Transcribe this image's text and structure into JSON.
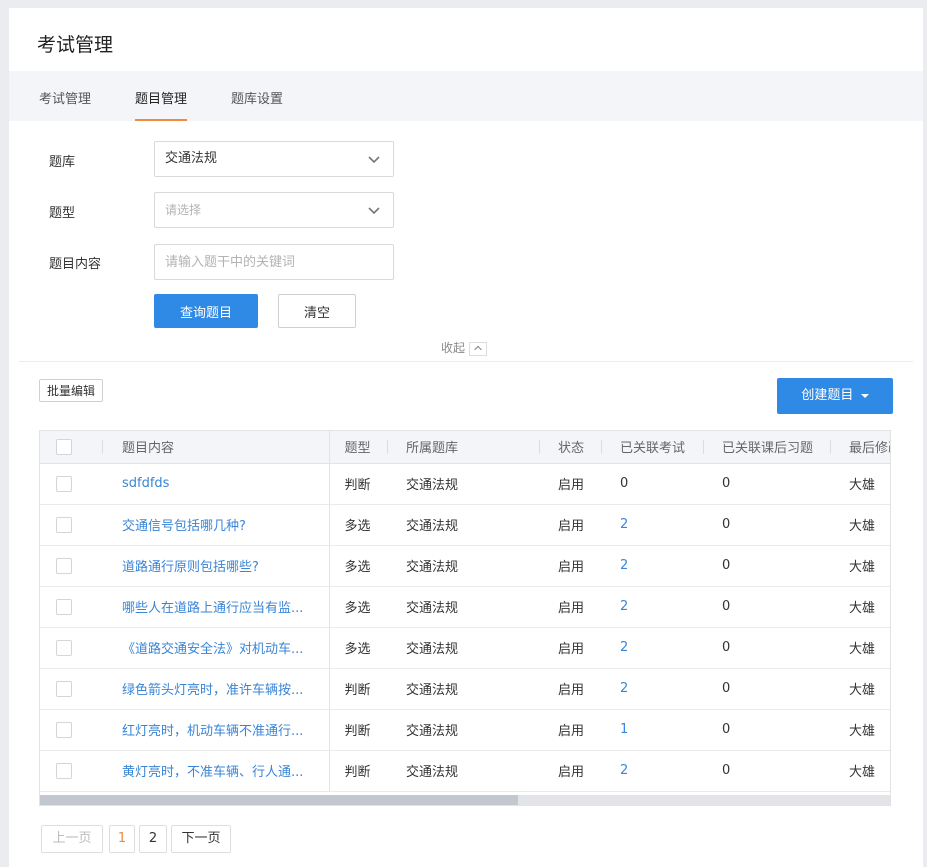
{
  "page": {
    "title": "考试管理"
  },
  "tabs": [
    {
      "label": "考试管理",
      "active": false
    },
    {
      "label": "题目管理",
      "active": true
    },
    {
      "label": "题库设置",
      "active": false
    }
  ],
  "filters": {
    "bank_label": "题库",
    "bank_value": "交通法规",
    "type_label": "题型",
    "type_placeholder": "请选择",
    "content_label": "题目内容",
    "content_placeholder": "请输入题干中的关键词",
    "search_button": "查询题目",
    "clear_button": "清空",
    "collapse_label": "收起"
  },
  "toolbar": {
    "batch_edit": "批量编辑",
    "create": "创建题目"
  },
  "table": {
    "columns": [
      "题目内容",
      "题型",
      "所属题库",
      "状态",
      "已关联考试",
      "已关联课后习题",
      "最后修改"
    ],
    "rows": [
      {
        "content": "sdfdfds",
        "type": "判断",
        "bank": "交通法规",
        "status": "启用",
        "exams": "0",
        "homework": "0",
        "modifier": "大雄"
      },
      {
        "content": "交通信号包括哪几种?",
        "type": "多选",
        "bank": "交通法规",
        "status": "启用",
        "exams": "2",
        "homework": "0",
        "modifier": "大雄"
      },
      {
        "content": "道路通行原则包括哪些?",
        "type": "多选",
        "bank": "交通法规",
        "status": "启用",
        "exams": "2",
        "homework": "0",
        "modifier": "大雄"
      },
      {
        "content": "哪些人在道路上通行应当有监...",
        "type": "多选",
        "bank": "交通法规",
        "status": "启用",
        "exams": "2",
        "homework": "0",
        "modifier": "大雄"
      },
      {
        "content": "《道路交通安全法》对机动车...",
        "type": "多选",
        "bank": "交通法规",
        "status": "启用",
        "exams": "2",
        "homework": "0",
        "modifier": "大雄"
      },
      {
        "content": "绿色箭头灯亮时，准许车辆按...",
        "type": "判断",
        "bank": "交通法规",
        "status": "启用",
        "exams": "2",
        "homework": "0",
        "modifier": "大雄"
      },
      {
        "content": "红灯亮时，机动车辆不准通行...",
        "type": "判断",
        "bank": "交通法规",
        "status": "启用",
        "exams": "1",
        "homework": "0",
        "modifier": "大雄"
      },
      {
        "content": "黄灯亮时，不准车辆、行人通...",
        "type": "判断",
        "bank": "交通法规",
        "status": "启用",
        "exams": "2",
        "homework": "0",
        "modifier": "大雄"
      }
    ]
  },
  "pagination": {
    "prev": "上一页",
    "pages": [
      "1",
      "2"
    ],
    "current": "1",
    "next": "下一页"
  },
  "colors": {
    "primary": "#2f8ae5",
    "link": "#3a85d6",
    "tab_underline": "#f08a3e",
    "current_page": "#f08a3e"
  }
}
